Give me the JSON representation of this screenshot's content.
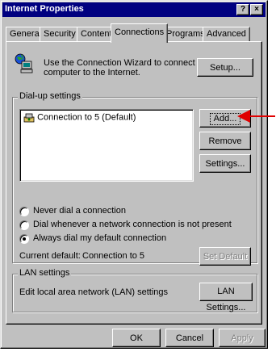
{
  "window": {
    "title": "Internet Properties",
    "help_label": "?",
    "close_label": "×"
  },
  "tabs": [
    {
      "label": "General",
      "active": false
    },
    {
      "label": "Security",
      "active": false
    },
    {
      "label": "Content",
      "active": false
    },
    {
      "label": "Connections",
      "active": true
    },
    {
      "label": "Programs",
      "active": false
    },
    {
      "label": "Advanced",
      "active": false
    }
  ],
  "wizard": {
    "text_line1": "Use the Connection Wizard to connect your",
    "text_line2": "computer to the Internet.",
    "setup_label": "Setup..."
  },
  "dialup": {
    "group_label": "Dial-up settings",
    "connections": [
      "Connection to 5 (Default)"
    ],
    "add_label": "Add...",
    "remove_label": "Remove",
    "settings_label": "Settings...",
    "options": [
      {
        "label": "Never dial a connection",
        "checked": false
      },
      {
        "label": "Dial whenever a network connection is not present",
        "checked": false
      },
      {
        "label": "Always dial my default connection",
        "checked": true
      }
    ],
    "current_default_label": "Current default:",
    "current_default_value": "Connection to 5",
    "set_default_label": "Set Default"
  },
  "lan": {
    "group_label": "LAN settings",
    "description": "Edit local area network (LAN) settings",
    "button_label": "LAN Settings..."
  },
  "footer": {
    "ok_label": "OK",
    "cancel_label": "Cancel",
    "apply_label": "Apply"
  },
  "colors": {
    "titlebar": "#000080",
    "face": "#c0c0c0",
    "annotation_arrow": "#e00000"
  }
}
